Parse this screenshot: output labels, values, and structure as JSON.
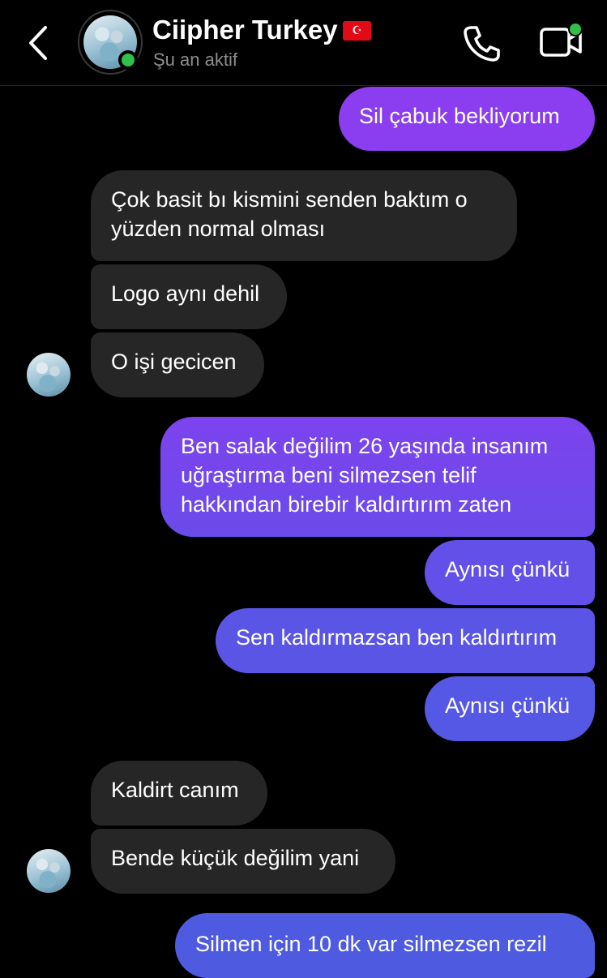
{
  "header": {
    "contact_name": "Ciipher Turkey",
    "flag": "🇹🇷",
    "status": "Şu an aktif",
    "icons": {
      "back": "chevron-left-icon",
      "call": "phone-icon",
      "video": "video-camera-icon"
    },
    "online_color": "#31c14a"
  },
  "messages": [
    {
      "from": "me",
      "text": "Sil çabuk bekliyorum"
    },
    {
      "from": "them",
      "lines": [
        "Çok basit bı kismini senden baktım o",
        "yüzden normal olması"
      ]
    },
    {
      "from": "them",
      "text": "Logo aynı dehil"
    },
    {
      "from": "them",
      "text": "O işi gecicen"
    },
    {
      "from": "me",
      "lines": [
        "Ben salak değilim 26 yaşında insanım",
        "uğraştırma beni silmezsen telif",
        "hakkından birebir kaldırtırım zaten"
      ]
    },
    {
      "from": "me",
      "text": "Aynısı çünkü"
    },
    {
      "from": "me",
      "text": "Sen kaldırmazsan ben kaldırtırım"
    },
    {
      "from": "me",
      "text": "Aynısı çünkü"
    },
    {
      "from": "them",
      "text": "Kaldirt canım"
    },
    {
      "from": "them",
      "text": "Bende küçük değilim yani"
    },
    {
      "from": "me",
      "text": "Silmen için 10 dk var silmezsen rezil"
    }
  ],
  "colors": {
    "incoming_bg": "#262626",
    "outgoing_gradient": [
      "#8b3df0",
      "#7a45ec",
      "#5b55e6",
      "#4e5ae0"
    ],
    "status_gray": "#8e8e8e"
  }
}
